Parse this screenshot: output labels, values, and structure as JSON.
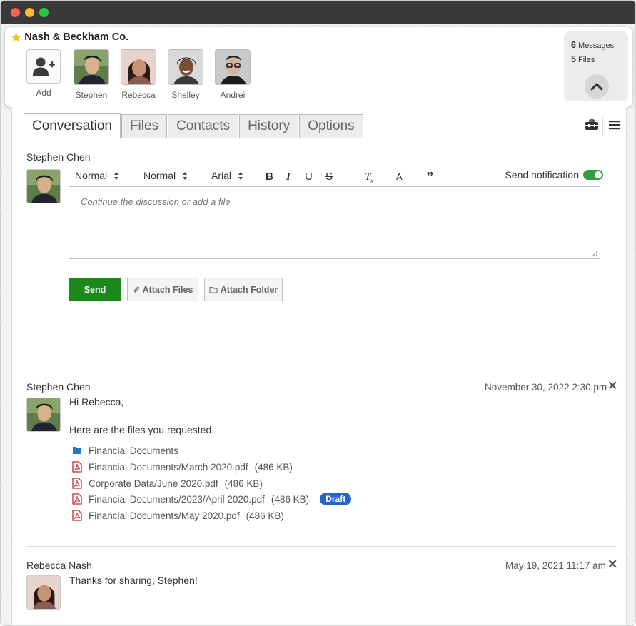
{
  "header": {
    "company": "Nash & Beckham Co.",
    "members": [
      {
        "label": "Add"
      },
      {
        "label": "Stephen"
      },
      {
        "label": "Rebecca"
      },
      {
        "label": "Shelley"
      },
      {
        "label": "Andrei"
      }
    ],
    "stats": {
      "messages_count": "6",
      "messages_label": "Messages",
      "files_count": "5",
      "files_label": "Files"
    }
  },
  "tabs": [
    "Conversation",
    "Files",
    "Contacts",
    "History",
    "Options"
  ],
  "active_tab": "Conversation",
  "composer": {
    "author": "Stephen Chen",
    "font_size_1": "Normal",
    "font_size_2": "Normal",
    "font_family": "Arial",
    "notification_label": "Send notification",
    "notification_on": true,
    "placeholder": "Continue the discussion or add a file",
    "send_label": "Send",
    "attach_files_label": "Attach Files",
    "attach_folder_label": "Attach Folder"
  },
  "messages": [
    {
      "author": "Stephen Chen",
      "date": "November 30, 2022 2:30 pm",
      "greeting": "Hi Rebecca,",
      "body": "Here are the files you requested.",
      "attachments": [
        {
          "type": "folder",
          "name": "Financial Documents",
          "size": ""
        },
        {
          "type": "pdf",
          "name": "Financial Documents/March 2020.pdf",
          "size": "(486 KB)"
        },
        {
          "type": "pdf",
          "name": "Corporate Data/June 2020.pdf",
          "size": "(486 KB)"
        },
        {
          "type": "pdf",
          "name": "Financial Documents/2023/April 2020.pdf",
          "size": "(486 KB)",
          "badge": "Draft"
        },
        {
          "type": "pdf",
          "name": "Financial Documents/May 2020.pdf",
          "size": "(486 KB)"
        }
      ]
    },
    {
      "author": "Rebecca Nash",
      "date": "May 19, 2021 11:17 am",
      "body": "Thanks for sharing, Stephen!"
    }
  ],
  "colors": {
    "accent_green": "#1b8a1b",
    "badge_blue": "#2066cc",
    "folder_blue": "#1f7bc1",
    "pdf_red": "#c62828",
    "star": "#f5b921"
  }
}
